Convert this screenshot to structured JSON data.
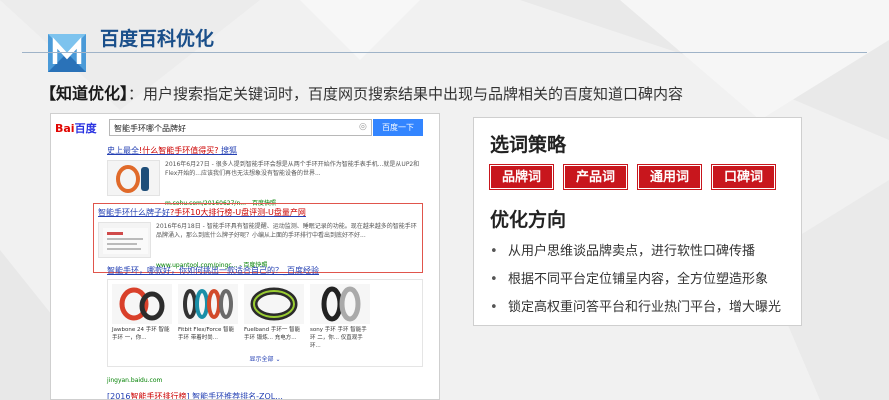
{
  "slide": {
    "title": "百度百科优化",
    "subtitle_label": "【知道优化】",
    "subtitle_text": "：用户搜索指定关键词时，百度网页搜索结果中出现与品牌相关的百度知道口碑内容"
  },
  "search": {
    "logo_text_a": "Bai",
    "logo_text_b": "百度",
    "query": "智能手环哪个品牌好",
    "button_label": "百度一下"
  },
  "results": [
    {
      "title_a": "史上最全",
      "title_em": "!什么智能手环值得买?",
      "title_b": " 搜狐",
      "snippet": "2016年6月27日 - 很多人提到智能手环会想是从两个手环开始作为智能手表手机...就是从UP2和Flex开始的...应该我们再也无法想象没有智能设备的世界...",
      "source": "m.sohu.com/20160627/n... - 百度快照"
    },
    {
      "title_a": "智能手环什么牌子好",
      "title_em": "?手环10大排行榜-U盘评测-U盘量产网",
      "title_b": "",
      "snippet": "2016年6月18日 - 智能手环具有智能提醒、运动监测、睡眠记录的功能。现在越来越多的智能手环品牌涌入，那么到底什么牌子好呢？小编从上面的手环排行中看出到底好不好...",
      "source": "www.upantool.com/pingc... - 百度快照"
    }
  ],
  "jingyan": {
    "title": "智能手环，哪款好，你如何挑出一款适合自己的？_百度经验",
    "images": [
      {
        "caption": "Jawbone 24 手环 智能手环 一，你..."
      },
      {
        "caption": "Fitbit Flex/Force 智能手环 带着时尚..."
      },
      {
        "caption": "Fuelband 手环一 智能手环 锻炼... 充电方..."
      },
      {
        "caption": "sony 手环 手环 智能手环 二，你... 仅直观手环..."
      }
    ],
    "more": "显示全部",
    "source": "jingyan.baidu.com"
  },
  "last_result": {
    "title_a": "[2016",
    "title_em": "智能手环排行榜",
    "title_b": "] 智能手环推荐排名-ZOL..."
  },
  "strategy": {
    "keywords_heading": "选词策略",
    "tags": [
      "品牌词",
      "产品词",
      "通用词",
      "口碑词"
    ],
    "direction_heading": "优化方向",
    "bullets": [
      "从用户思维谈品牌卖点，进行软性口碑传播",
      "根据不同平台定位铺呈内容，全方位塑造形象",
      "锁定高权重问答平台和行业热门平台，增大曝光"
    ]
  },
  "colors": {
    "accent_red": "#c8161d",
    "title_blue": "#1a4f8a",
    "link_blue": "#2440b3",
    "baidu_button": "#3385ff"
  }
}
